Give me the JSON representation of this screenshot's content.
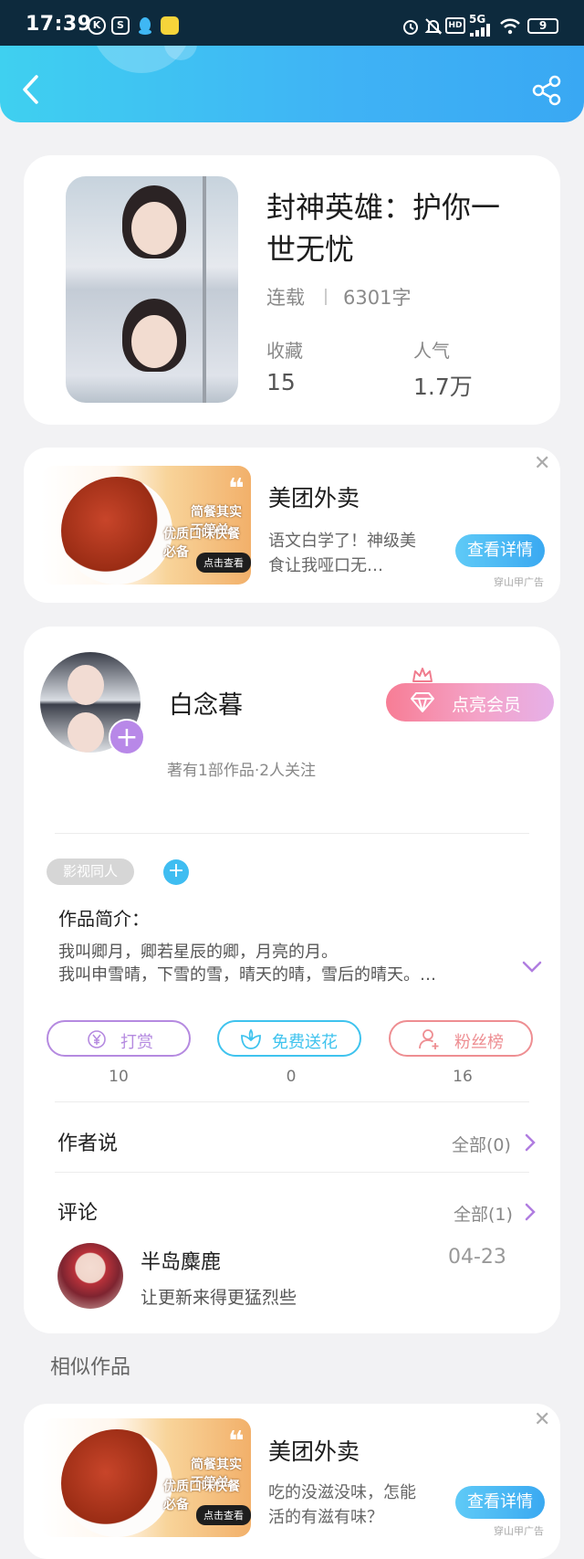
{
  "status_bar": {
    "time": "17:39",
    "left_icons": [
      "K",
      "S"
    ],
    "network": "5G",
    "battery": "9"
  },
  "header": {
    "back_icon": "chevron-left-icon",
    "share_icon": "share-icon"
  },
  "book": {
    "title": "封神英雄：护你一世无忧",
    "status": "连载",
    "word_count": "6301字",
    "favorites_label": "收藏",
    "favorites_value": "15",
    "popularity_label": "人气",
    "popularity_value": "1.7万"
  },
  "ad1": {
    "image_text_1": "简餐其实不简单",
    "image_text_2": "优质口味快餐必备",
    "image_button": "点击查看",
    "title": "美团外卖",
    "desc": "语文白学了！神级美食让我哑口无…",
    "cta": "查看详情",
    "source": "穿山甲广告"
  },
  "author": {
    "name": "白念暮",
    "sub": "著有1部作品·2人关注",
    "vip_label": "点亮会员",
    "tag": "影视同人",
    "intro_label": "作品简介：",
    "intro_line1": "我叫卿月，卿若星辰的卿，月亮的月。",
    "intro_line2": "我叫申雪晴，下雪的雪，晴天的晴，雪后的晴天。…"
  },
  "actions": [
    {
      "label": "打赏",
      "count": "10",
      "color": "#b58ae0"
    },
    {
      "label": "免费送花",
      "count": "0",
      "color": "#3fc3ee"
    },
    {
      "label": "粉丝榜",
      "count": "16",
      "color": "#ee8e92"
    }
  ],
  "author_says": {
    "title": "作者说",
    "all": "全部(0)"
  },
  "comments": {
    "title": "评论",
    "all": "全部(1)",
    "items": [
      {
        "user": "半岛麋鹿",
        "date": "04-23",
        "text": "让更新来得更猛烈些"
      }
    ]
  },
  "similar": {
    "title": "相似作品"
  },
  "ad2": {
    "image_text_1": "简餐其实不简单",
    "image_text_2": "优质口味快餐必备",
    "image_button": "点击查看",
    "title": "美团外卖",
    "desc": "吃的没滋没味，怎能活的有滋有味？",
    "cta": "查看详情",
    "source": "穿山甲广告"
  }
}
